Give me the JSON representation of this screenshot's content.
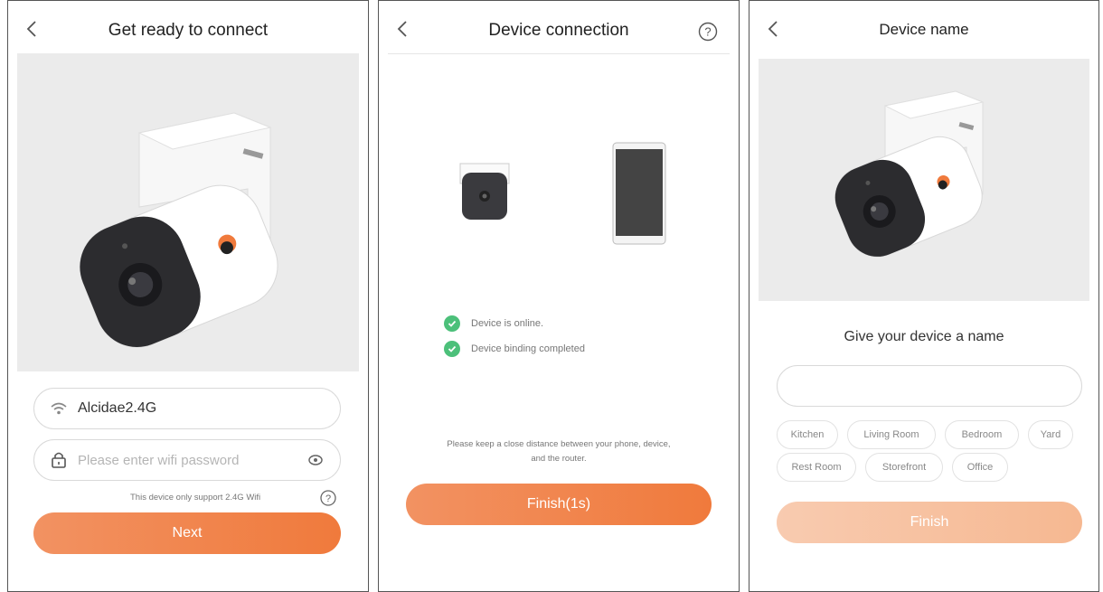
{
  "screen1": {
    "title": "Get ready to connect",
    "wifi_name": "Alcidae2.4G",
    "password_placeholder": "Please enter wifi password",
    "support_note": "This device only support 2.4G Wifi",
    "next_label": "Next"
  },
  "screen2": {
    "title": "Device connection",
    "status": [
      {
        "text": "Device is online."
      },
      {
        "text": "Device binding completed"
      }
    ],
    "distance_note_line1": "Please keep a close distance between your phone, device,",
    "distance_note_line2": "and the router.",
    "finish_label": "Finish(1s)"
  },
  "screen3": {
    "title": "Device name",
    "prompt": "Give your device a name",
    "name_value": "",
    "tags": [
      "Kitchen",
      "Living Room",
      "Bedroom",
      "Yard",
      "Rest Room",
      "Storefront",
      "Office"
    ],
    "finish_label": "Finish"
  },
  "colors": {
    "accent": "#f07a3c",
    "accent_light": "#f29262",
    "accent_disabled": "#f6b891",
    "success": "#4cc07a",
    "hero_bg": "#ebebeb"
  },
  "icons": [
    "chevron-left-icon",
    "help-circle-icon",
    "wifi-icon",
    "lock-icon",
    "eye-icon",
    "check-icon"
  ]
}
